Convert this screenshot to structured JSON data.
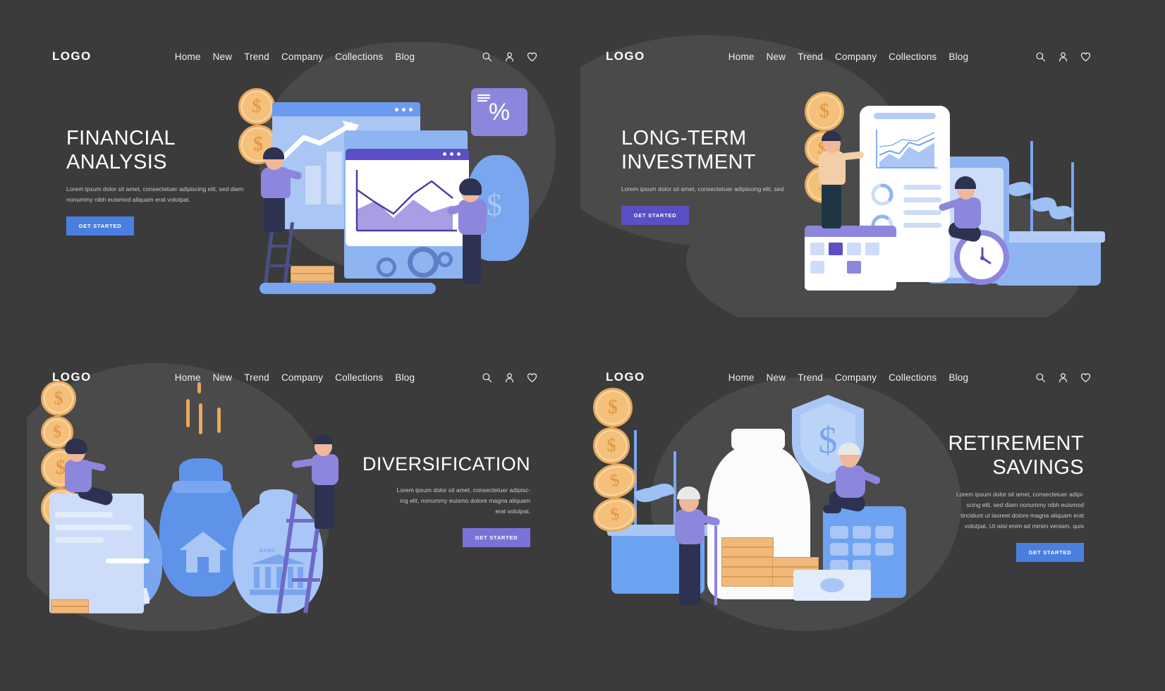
{
  "meta": {
    "page_background": "#3a3a3a",
    "panel_background": "#3b3b3b",
    "blob_color": "#4a4a4a",
    "layout": "2x2 grid of dark landing page mockups"
  },
  "nav": {
    "logo": "LOGO",
    "links": [
      "Home",
      "New",
      "Trend",
      "Company",
      "Collections",
      "Blog"
    ],
    "icons": [
      "search-icon",
      "user-icon",
      "heart-icon"
    ]
  },
  "panels": [
    {
      "id": "financial-analysis",
      "title": "FINANCIAL\nANALYSIS",
      "subtitle": "Lorem ipsum dolor sit amet, consectetuer adipiscing elit, sed diam\nnonummy nibh euismod aliquam erat volutpat.",
      "cta": "GET STARTED",
      "cta_color": "#4a7fe0",
      "align": "left",
      "illustration": "financial-analysis-illustration",
      "percent_symbol": "%",
      "currency_symbol": "$"
    },
    {
      "id": "long-term-investment",
      "title": "LONG-TERM\nINVESTMENT",
      "subtitle": "Lorem ipsum dolor sit amet, consectetuer adipiscing elit, sed",
      "cta": "GET STARTED",
      "cta_color": "#5a4fc4",
      "align": "left",
      "illustration": "long-term-investment-illustration",
      "currency_symbol": "$"
    },
    {
      "id": "diversification",
      "title": "DIVERSIFICATION",
      "subtitle": "Lorem ipsum dolor sit amet, consectetuer adipisc-\ning elit, nonummy euismo dolore magna aliquam\nerat volutpat.",
      "cta": "GET STARTED",
      "cta_color": "#7b72d8",
      "align": "right",
      "illustration": "diversification-illustration",
      "bank_label": "BANK",
      "currency_symbol": "$"
    },
    {
      "id": "retirement-savings",
      "title": "RETIREMENT\nSAVINGS",
      "subtitle": "Lorem ipsum dolor sit amet, consectetuer adipi-\nscing elit, sed diam nonummy nibh euismod\ntincidunt ut laoreet dolore magna aliquam erat\nvolutpat. Ut wisi enim ad minim veniam, quis",
      "cta": "GET STARTED",
      "cta_color": "#4a7fe0",
      "align": "right",
      "illustration": "retirement-savings-illustration",
      "currency_symbol": "$"
    }
  ]
}
